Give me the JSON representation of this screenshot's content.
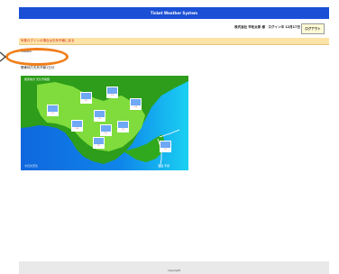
{
  "header": {
    "title": "Ticket Weather System"
  },
  "user_bar": {
    "user_info": "株式会社 平松太郎 様　ログイン中 12月17日",
    "logout_label": "ログアウト"
  },
  "notice": {
    "text": "気象ログインの場合は天気予報に戻る"
  },
  "nav": {
    "back_label": "戻る"
  },
  "section": {
    "title": "関東地方天気予報1日分"
  },
  "map": {
    "label_top_left": "関東地方 天気予報図",
    "label_bottom_left": "今日の天気",
    "label_bottom_right": "気温 予報"
  },
  "footer": {
    "text": "copyright"
  },
  "colors": {
    "title_bar": "#1a4fd6",
    "notice_bg": "#fde3a6",
    "notice_text": "#d82a1f",
    "land": "#3fae1f",
    "sea_light": "#19c6ee",
    "highlight": "#f07e1a"
  }
}
